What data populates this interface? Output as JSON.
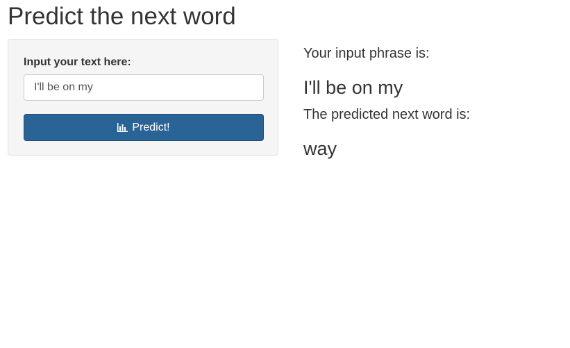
{
  "page": {
    "title": "Predict the next word"
  },
  "sidebar": {
    "input_label": "Input your text here:",
    "input_value": "I'll be on my",
    "button_label": "Predict!",
    "button_icon": "bar-chart-icon"
  },
  "output": {
    "input_phrase_label": "Your input phrase is:",
    "input_phrase": "I'll be on my",
    "prediction_label": "The predicted next word is:",
    "prediction": "way"
  },
  "colors": {
    "button_bg": "#2a6496",
    "well_bg": "#f5f5f5",
    "text": "#333333"
  }
}
